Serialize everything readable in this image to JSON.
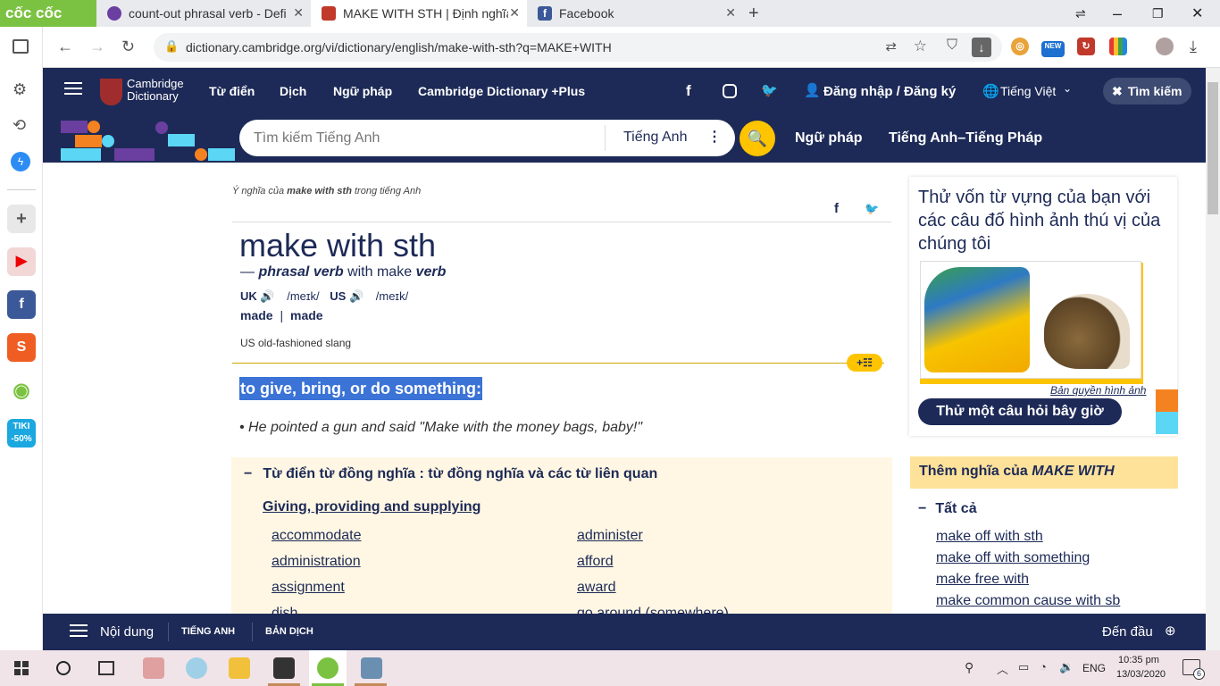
{
  "browser": {
    "brand": "cốc cốc",
    "tabs": [
      {
        "title": "count-out phrasal verb - Defi",
        "color": "#6a3fa0"
      },
      {
        "title": "MAKE WITH STH | Định nghĩa",
        "color": "#c0392b"
      },
      {
        "title": "Facebook",
        "color": "#3b5998"
      }
    ],
    "url": "dictionary.cambridge.org/vi/dictionary/english/make-with-sth?q=MAKE+WITH",
    "new_badge": "NEW"
  },
  "header": {
    "logo": "Cambridge Dictionary",
    "nav": [
      "Từ điển",
      "Dịch",
      "Ngữ pháp",
      "Cambridge Dictionary +Plus"
    ],
    "login": "Đăng nhập / Đăng ký",
    "language": "Tiếng Việt",
    "search_toggle": "Tìm kiếm"
  },
  "search": {
    "placeholder": "Tìm kiếm Tiếng Anh",
    "dict": "Tiếng Anh",
    "links": [
      "Ngữ pháp",
      "Tiếng Anh–Tiếng Pháp"
    ]
  },
  "entry": {
    "breadcrumb_pre": "Ý nghĩa của",
    "breadcrumb_word": "make with sth",
    "breadcrumb_post": "trong tiếng Anh",
    "headword": "make with sth",
    "pos_dash": "—",
    "pos": "phrasal verb",
    "pos_with": "with make",
    "pos_verb": "verb",
    "uk": "UK",
    "uk_ipa": "/meɪk/",
    "us": "US",
    "us_ipa": "/meɪk/",
    "forms": [
      "made",
      "made"
    ],
    "forms_sep": "|",
    "usage": "US old-fashioned slang",
    "definition": "to give, bring, or do something:",
    "example": "He pointed a gun and said \"Make with the money bags, baby!\"",
    "thesaurus_title": "Từ điển từ đồng nghĩa : từ đồng nghĩa và các từ liên quan",
    "thesaurus_group": "Giving, providing and supplying",
    "thesaurus_left": [
      "accommodate",
      "administration",
      "assignment",
      "dish"
    ],
    "thesaurus_right": [
      "administer",
      "afford",
      "award",
      "go around (somewhere)"
    ]
  },
  "sidebar_right": {
    "quiz_title": "Thử vốn từ vựng của bạn với các câu đố hình ảnh thú vị của chúng tôi",
    "copyright": "Bản quyền hình ảnh",
    "quiz_button": "Thử một câu hỏi bây giờ",
    "more_title_pre": "Thêm nghĩa của",
    "more_title_word": "MAKE WITH",
    "all": "Tất cả",
    "more_links": [
      "make off with sth",
      "make off with something",
      "make free with",
      "make common cause with sb"
    ]
  },
  "footer": {
    "contents": "Nội dung",
    "tab1": "TIẾNG ANH",
    "tab2": "BẢN DỊCH",
    "top": "Đến đầu"
  },
  "taskbar": {
    "lang": "ENG",
    "time": "10:35 pm",
    "date": "13/03/2020",
    "notif": "6"
  },
  "colors": {
    "navy": "#1d2a57",
    "yellow": "#fec400",
    "highlight": "#3b73d6",
    "thesaurus_bg": "#fff7e3"
  }
}
